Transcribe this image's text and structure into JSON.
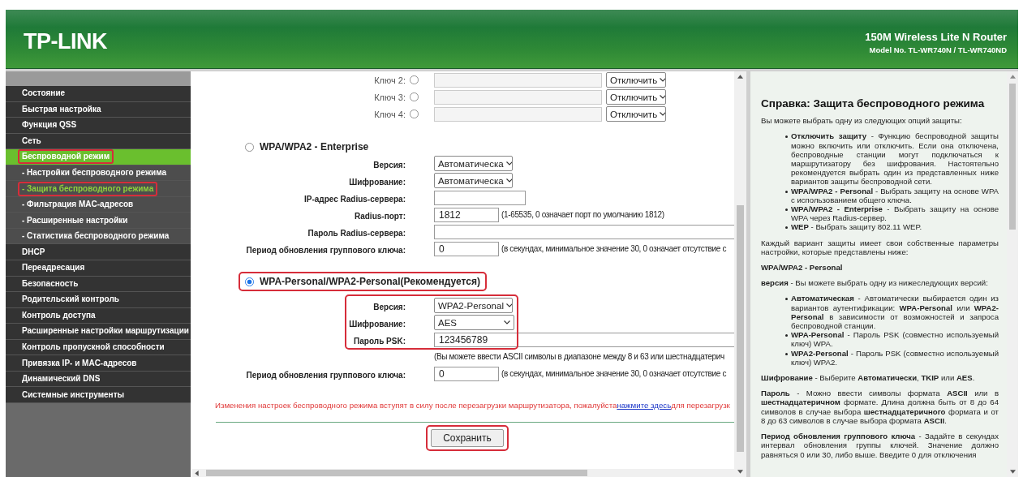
{
  "header": {
    "logo": "TP-LINK",
    "product": "150M Wireless Lite N Router",
    "model": "Model No. TL-WR740N / TL-WR740ND"
  },
  "sidebar": {
    "items": [
      {
        "label": "Состояние",
        "kind": "section",
        "selected": false,
        "highlighted": false
      },
      {
        "label": "Быстрая настройка",
        "kind": "section",
        "selected": false,
        "highlighted": false
      },
      {
        "label": "Функция QSS",
        "kind": "section",
        "selected": false,
        "highlighted": false
      },
      {
        "label": "Сеть",
        "kind": "section",
        "selected": false,
        "highlighted": false
      },
      {
        "label": "Беспроводной режим",
        "kind": "section",
        "selected": true,
        "highlighted": true
      },
      {
        "label": "- Настройки беспроводного режима",
        "kind": "sub",
        "selected": false,
        "highlighted": false
      },
      {
        "label": "- Защита беспроводного режима",
        "kind": "sub",
        "selected": true,
        "highlighted": true
      },
      {
        "label": "- Фильтрация MAC-адресов",
        "kind": "sub",
        "selected": false,
        "highlighted": false
      },
      {
        "label": "- Расширенные настройки",
        "kind": "sub",
        "selected": false,
        "highlighted": false
      },
      {
        "label": "- Статистика беспроводного режима",
        "kind": "sub",
        "selected": false,
        "highlighted": false
      },
      {
        "label": "DHCP",
        "kind": "section",
        "selected": false,
        "highlighted": false
      },
      {
        "label": "Переадресация",
        "kind": "section",
        "selected": false,
        "highlighted": false
      },
      {
        "label": "Безопасность",
        "kind": "section",
        "selected": false,
        "highlighted": false
      },
      {
        "label": "Родительский контроль",
        "kind": "section",
        "selected": false,
        "highlighted": false
      },
      {
        "label": "Контроль доступа",
        "kind": "section",
        "selected": false,
        "highlighted": false
      },
      {
        "label": "Расширенные настройки маршрутизации",
        "kind": "section",
        "selected": false,
        "highlighted": false
      },
      {
        "label": "Контроль пропускной способности",
        "kind": "section",
        "selected": false,
        "highlighted": false
      },
      {
        "label": "Привязка IP- и MAC-адресов",
        "kind": "section",
        "selected": false,
        "highlighted": false
      },
      {
        "label": "Динамический DNS",
        "kind": "section",
        "selected": false,
        "highlighted": false
      },
      {
        "label": "Системные инструменты",
        "kind": "section",
        "selected": false,
        "highlighted": false
      }
    ]
  },
  "form": {
    "wep_keys": [
      {
        "label": "Ключ 2:",
        "selected": false,
        "disabled": true,
        "type": "Отключить"
      },
      {
        "label": "Ключ 3:",
        "selected": false,
        "disabled": true,
        "type": "Отключить"
      },
      {
        "label": "Ключ 4:",
        "selected": false,
        "disabled": true,
        "type": "Отключить"
      }
    ],
    "sections": [
      {
        "title": "WPA/WPA2 - Enterprise",
        "selected": false,
        "highlighted": false,
        "rows": [
          {
            "kind": "select",
            "label": "Версия:",
            "value": "Автоматическа"
          },
          {
            "kind": "select",
            "label": "Шифрование:",
            "value": "Автоматическа"
          },
          {
            "kind": "medium-input",
            "label": "IP-адрес Radius-сервера:"
          },
          {
            "kind": "short-input",
            "label": "Radius-порт:",
            "value": "1812",
            "note": "(1-65535, 0 означает порт по умолчанию 1812)"
          },
          {
            "kind": "wide-input",
            "label": "Пароль Radius-сервера:"
          },
          {
            "kind": "short-input",
            "label": "Период обновления группового ключа:",
            "value": "0",
            "note": "(в секундах, минимальное значение 30, 0 означает отсутствие с"
          }
        ]
      },
      {
        "title": "WPA-Personal/WPA2-Personal(Рекомендуется)",
        "selected": true,
        "highlighted": true,
        "rows": [
          {
            "kind": "group",
            "highlighted": true,
            "rows": [
              {
                "kind": "select",
                "label": "Версия:",
                "value": "WPA2-Personal"
              },
              {
                "kind": "select",
                "label": "Шифрование:",
                "value": "AES"
              },
              {
                "kind": "wide-input",
                "label": "Пароль PSK:",
                "value": "123456789"
              }
            ]
          },
          {
            "kind": "note",
            "note": "(Вы можете ввести ASCII символы в диапазоне между 8 и 63 или шестнадцатерич"
          },
          {
            "kind": "short-input",
            "label": "Период обновления группового ключа:",
            "value": "0",
            "note": "(в секундах, минимальное значение 30, 0 означает отсутствие с"
          }
        ]
      }
    ],
    "message": {
      "text": "Изменения настроек беспроводного режима вступят в силу после перезагрузки маршрутизатора, пожалуйста",
      "link": "нажмите здесь",
      "after": "для перезагрузк"
    },
    "save_button": {
      "label": "Сохранить",
      "highlighted": true
    }
  },
  "help": {
    "blocks": [
      {
        "kind": "heading",
        "text": "Справка: Защита беспроводного режима"
      },
      {
        "kind": "para",
        "text": "Вы можете выбрать одну из следующих опций защиты:"
      },
      {
        "kind": "list",
        "items": [
          "**Отключить защиту** - Функцию беспроводной защиты можно включить или отключить. Если она отключена, беспроводные станции могут подключаться к маршрутизатору без шифрования. Настоятельно рекомендуется выбрать один из представленных ниже вариантов защиты беспроводной сети.",
          "**WPA/WPA2 - Personal** - Выбрать защиту на основе WPA с использованием общего ключа.",
          "**WPA/WPA2 - Enterprise** - Выбрать защиту на основе WPA через Radius-сервер.",
          "**WEP** - Выбрать защиту 802.11 WEP."
        ]
      },
      {
        "kind": "para",
        "text": "Каждый вариант защиты имеет свои собственные параметры настройки, которые представлены ниже:"
      },
      {
        "kind": "subheading",
        "text": "WPA/WPA2 - Personal"
      },
      {
        "kind": "para",
        "text": "**версия** -  Вы можете выбрать одну из нижеследующих версий:"
      },
      {
        "kind": "list",
        "items": [
          "**Автоматическая** - Автоматически выбирается один из вариантов аутентификации: **WPA-Personal** или **WPA2-Personal** в зависимости от возможностей и запроса беспроводной станции.",
          "**WPA-Personal** - Пароль PSK (совместно используемый ключ) WPA.",
          "**WPA2-Personal** - Пароль PSK (совместно используемый ключ) WPA2."
        ]
      },
      {
        "kind": "para",
        "text": "**Шифрование** - Выберите **Автоматически**, **TKIP** или **AES**."
      },
      {
        "kind": "para",
        "text": "**Пароль** - Можно ввести символы формата **ASCII** или в **шестнадцатеричном** формате. Длина должна быть от 8 до 64 символов в случае выбора **шестнадцатеричного** формата и от 8 до 63 символов в случае выбора формата **ASCII**."
      },
      {
        "kind": "para",
        "text": "**Период обновления группового ключа** - Задайте в секундах интервал обновления группы ключей. Значение должно равняться 0 или 30, либо выше. Введите 0 для отключения"
      }
    ]
  }
}
